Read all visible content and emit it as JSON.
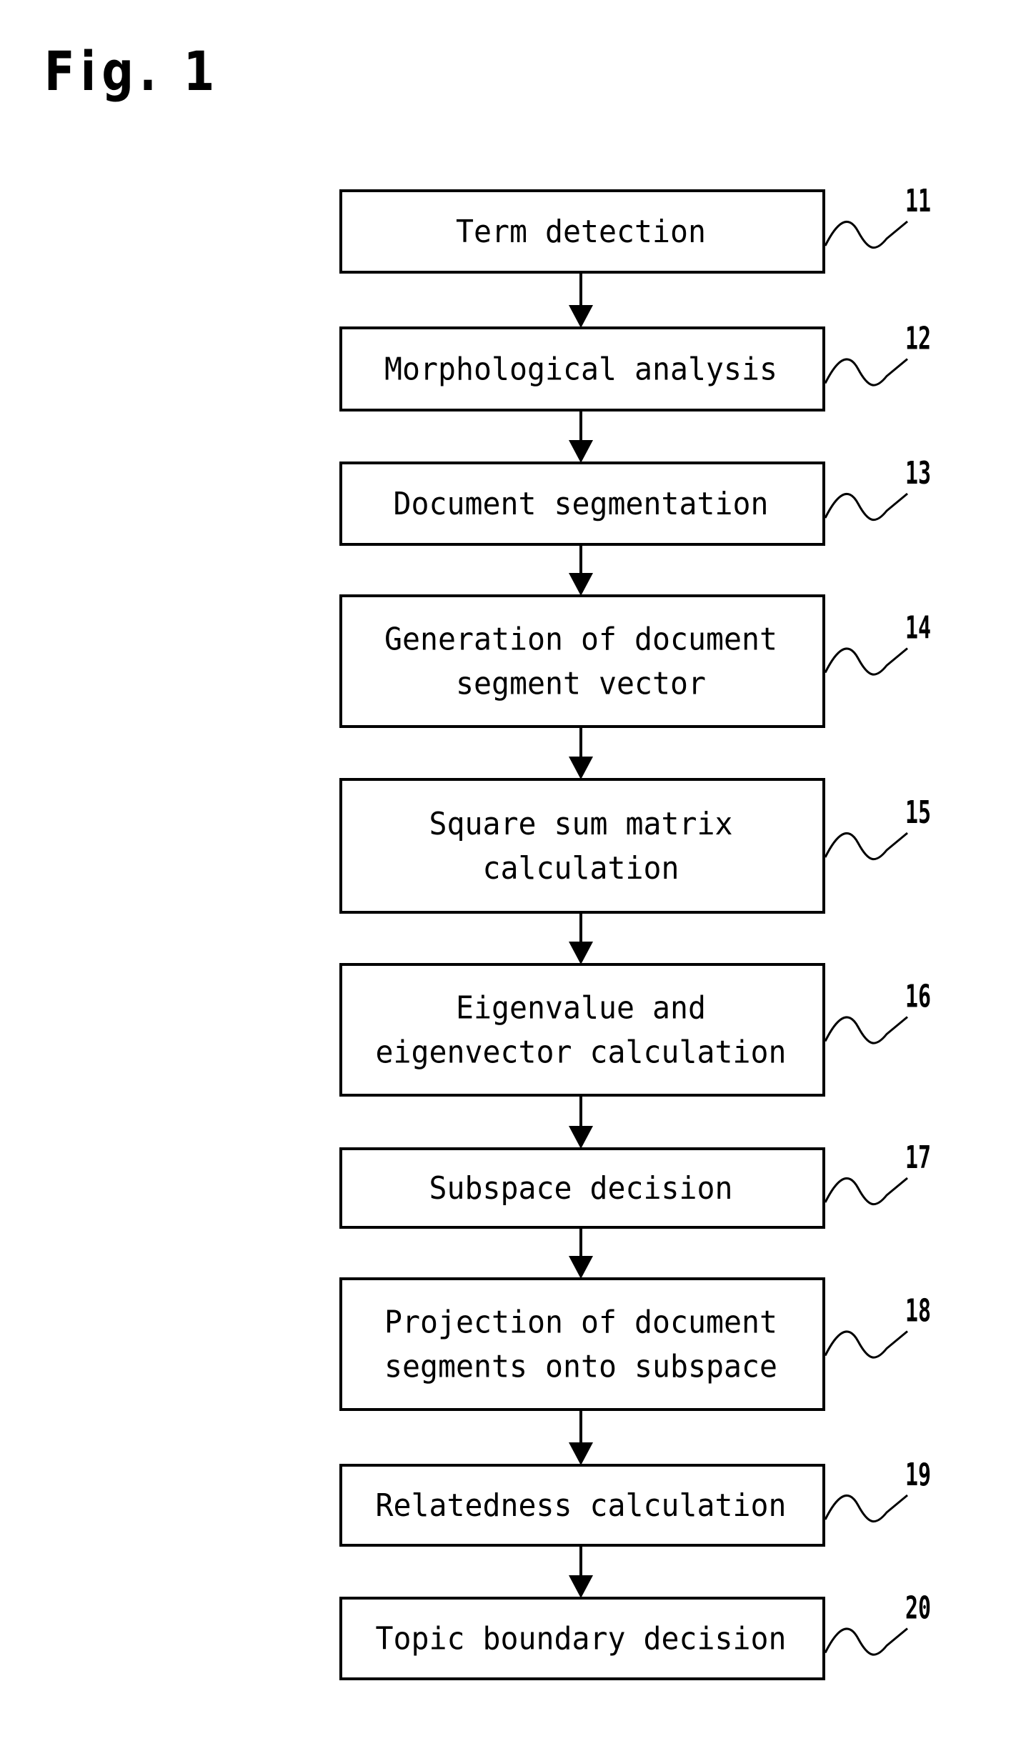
{
  "figure": {
    "title": "Fig. 1",
    "steps": [
      {
        "ref": "11",
        "lines": [
          "Term detection"
        ]
      },
      {
        "ref": "12",
        "lines": [
          "Morphological analysis"
        ]
      },
      {
        "ref": "13",
        "lines": [
          "Document segmentation"
        ]
      },
      {
        "ref": "14",
        "lines": [
          "Generation of document",
          "segment vector"
        ]
      },
      {
        "ref": "15",
        "lines": [
          "Square sum matrix",
          "calculation"
        ]
      },
      {
        "ref": "16",
        "lines": [
          "Eigenvalue and",
          "eigenvector calculation"
        ]
      },
      {
        "ref": "17",
        "lines": [
          "Subspace decision"
        ]
      },
      {
        "ref": "18",
        "lines": [
          "Projection of document",
          "segments onto subspace"
        ]
      },
      {
        "ref": "19",
        "lines": [
          "Relatedness calculation"
        ]
      },
      {
        "ref": "20",
        "lines": [
          "Topic boundary decision"
        ]
      }
    ],
    "colors": {
      "stroke": "#000000",
      "background": "#ffffff"
    }
  }
}
